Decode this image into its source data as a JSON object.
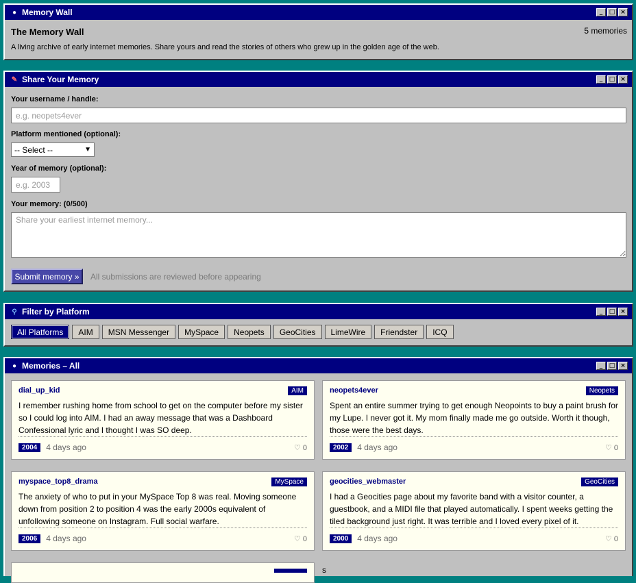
{
  "wall": {
    "window_title": "Memory Wall",
    "heading": "The Memory Wall",
    "count": "5 memories",
    "description": "A living archive of early internet memories. Share yours and read the stories of others who grew up in the golden age of the web."
  },
  "share": {
    "window_title": "Share Your Memory",
    "username_label": "Your username / handle:",
    "username_placeholder": "e.g. neopets4ever",
    "platform_label": "Platform mentioned (optional):",
    "platform_selected": "-- Select --",
    "year_label": "Year of memory (optional):",
    "year_placeholder": "e.g. 2003",
    "memory_label": "Your memory: (0/500)",
    "memory_placeholder": "Share your earliest internet memory...",
    "submit_label": "Submit memory »",
    "review_note": "All submissions are reviewed before appearing"
  },
  "filter": {
    "window_title": "Filter by Platform",
    "buttons": [
      "All Platforms",
      "AIM",
      "MSN Messenger",
      "MySpace",
      "Neopets",
      "GeoCities",
      "LimeWire",
      "Friendster",
      "ICQ"
    ]
  },
  "memories": {
    "window_title": "Memories – All",
    "stray_char": "s",
    "cards": [
      {
        "user": "dial_up_kid",
        "platform": "AIM",
        "text": "I remember rushing home from school to get on the computer before my sister so I could log into AIM. I had an away message that was a Dashboard Confessional lyric and I thought I was SO deep.",
        "year": "2004",
        "ago": "4 days ago",
        "likes": "♡ 0"
      },
      {
        "user": "neopets4ever",
        "platform": "Neopets",
        "text": "Spent an entire summer trying to get enough Neopoints to buy a paint brush for my Lupe. I never got it. My mom finally made me go outside. Worth it though, those were the best days.",
        "year": "2002",
        "ago": "4 days ago",
        "likes": "♡ 0"
      },
      {
        "user": "myspace_top8_drama",
        "platform": "MySpace",
        "text": "The anxiety of who to put in your MySpace Top 8 was real. Moving someone down from position 2 to position 4 was the early 2000s equivalent of unfollowing someone on Instagram. Full social warfare.",
        "year": "2006",
        "ago": "4 days ago",
        "likes": "♡ 0"
      },
      {
        "user": "geocities_webmaster",
        "platform": "GeoCities",
        "text": "I had a Geocities page about my favorite band with a visitor counter, a guestbook, and a MIDI file that played automatically. I spent weeks getting the tiled background just right. It was terrible and I loved every pixel of it.",
        "year": "2000",
        "ago": "4 days ago",
        "likes": "♡ 0"
      }
    ]
  }
}
